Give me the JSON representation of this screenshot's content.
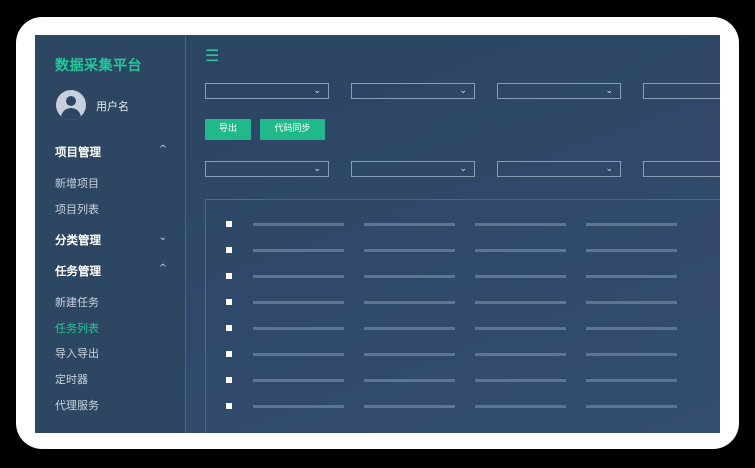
{
  "sidebar": {
    "brand": "数据采集平台",
    "username": "用户名",
    "groups": [
      {
        "label": "项目管理",
        "chevron": "^",
        "items": [
          "新增项目",
          "项目列表"
        ]
      },
      {
        "label": "分类管理",
        "chevron": "⌄",
        "items": []
      },
      {
        "label": "任务管理",
        "chevron": "^",
        "items": [
          "新建任务",
          "任务列表",
          "导入导出",
          "定时器",
          "代理服务"
        ]
      }
    ],
    "active_item": "任务列表"
  },
  "header": {
    "menu_icon": "hamburger-icon"
  },
  "toolbar": {
    "export_label": "导出",
    "sync_label": "代码同步"
  },
  "filters": {
    "chevron": "⌄"
  },
  "table": {
    "row_count": 8,
    "column_count": 4
  },
  "colors": {
    "accent": "#1ec99a",
    "button": "#1fb98a",
    "background": "#30496a"
  }
}
